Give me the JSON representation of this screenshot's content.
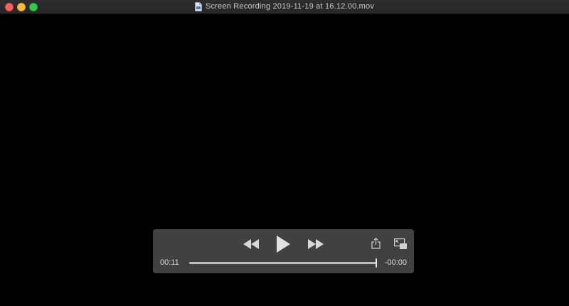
{
  "window": {
    "title": "Screen Recording 2019-11-19 at 16.12.00.mov",
    "colors": {
      "close": "#fc605c",
      "minimize": "#fdbc40",
      "zoom": "#34c84a"
    },
    "icons": [
      "document-icon"
    ]
  },
  "player": {
    "elapsed": "00:11",
    "remaining": "-00:00",
    "progress": 1.0,
    "icons": [
      "rewind-icon",
      "play-icon",
      "fast-forward-icon",
      "share-icon",
      "picture-in-picture-icon"
    ]
  }
}
